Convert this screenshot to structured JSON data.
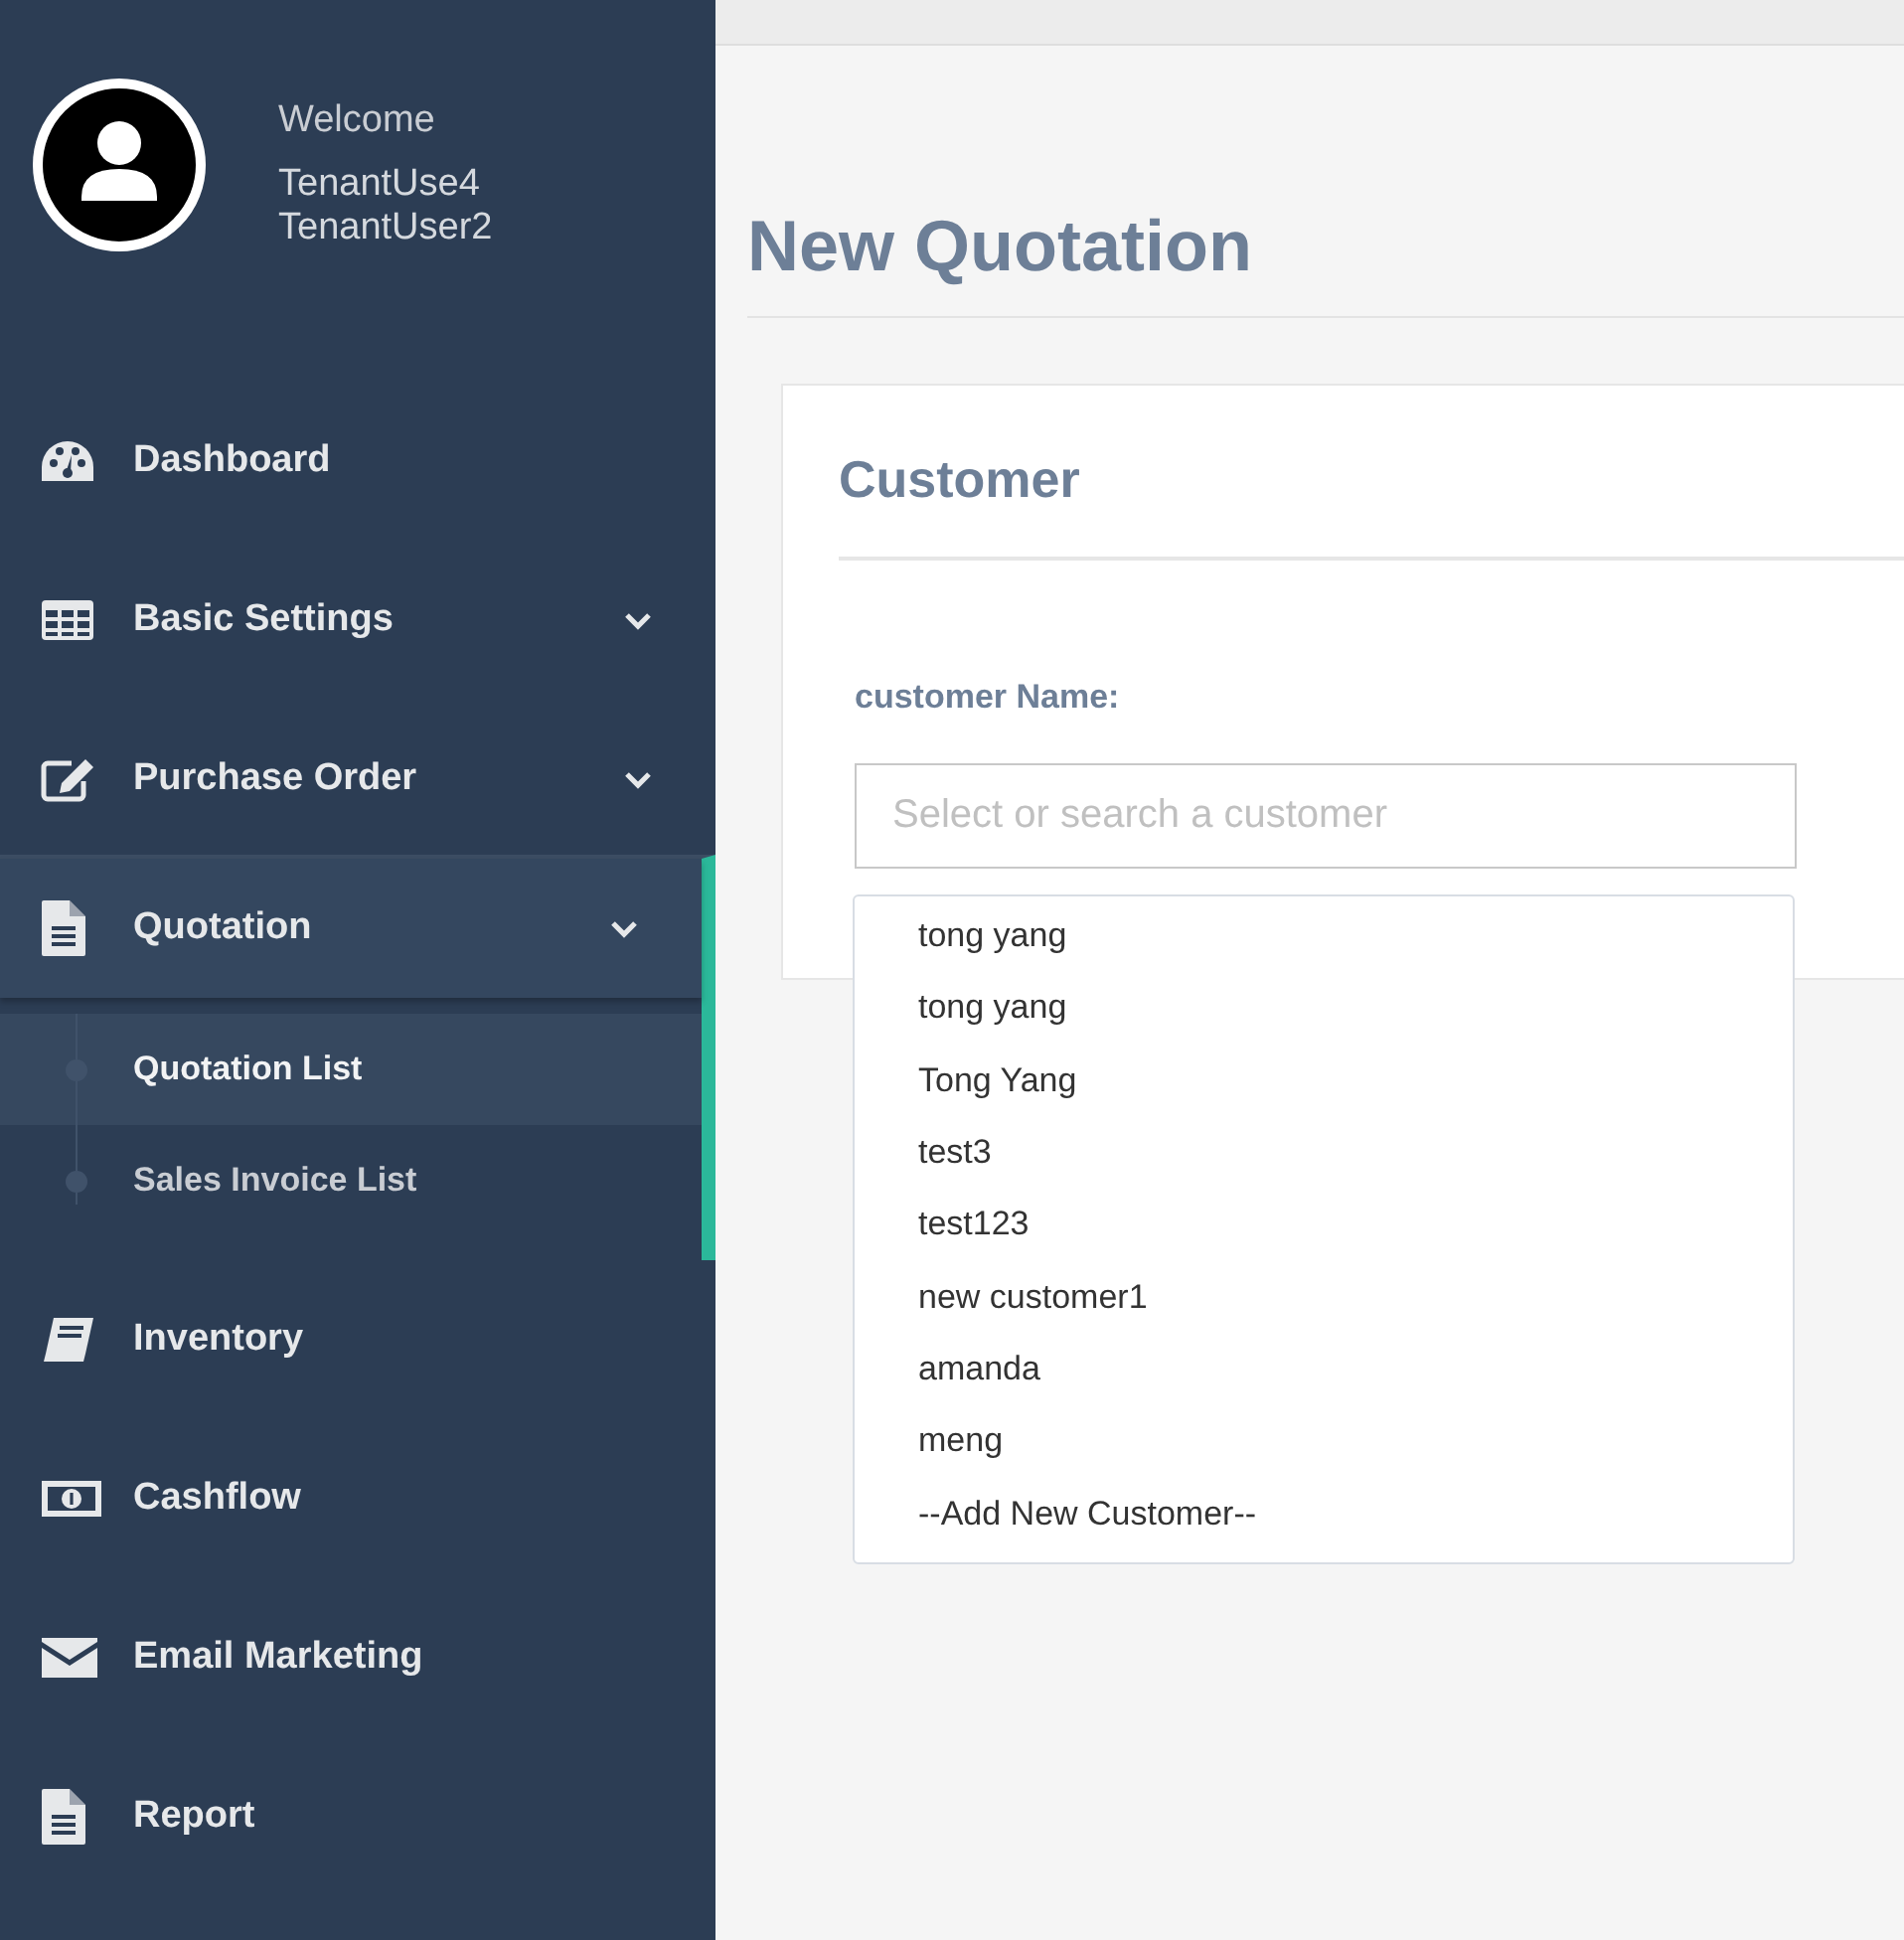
{
  "user": {
    "welcome": "Welcome",
    "names": [
      "TenantUse4",
      "TenantUser2"
    ]
  },
  "menu": [
    {
      "label": "Dashboard",
      "expandable": false,
      "selected": false
    },
    {
      "label": "Basic Settings",
      "expandable": true,
      "selected": false
    },
    {
      "label": "Purchase Order",
      "expandable": true,
      "selected": false
    },
    {
      "label": "Quotation",
      "expandable": true,
      "selected": true,
      "expanded": true,
      "children": [
        {
          "label": "Quotation List",
          "selected": true
        },
        {
          "label": "Sales Invoice List",
          "selected": false
        }
      ]
    },
    {
      "label": "Inventory",
      "expandable": false,
      "selected": false
    },
    {
      "label": "Cashflow",
      "expandable": false,
      "selected": false
    },
    {
      "label": "Email Marketing",
      "expandable": false,
      "selected": false
    },
    {
      "label": "Report",
      "expandable": false,
      "selected": false
    }
  ],
  "page": {
    "title": "New Quotation"
  },
  "card": {
    "title": "Customer",
    "field_label": "customer Name:",
    "placeholder": "Select or search a customer",
    "options": [
      "tong yang",
      "tong yang",
      "Tong Yang",
      "test3",
      "test123",
      "new customer1",
      "amanda",
      "meng",
      "--Add New Customer--"
    ]
  }
}
